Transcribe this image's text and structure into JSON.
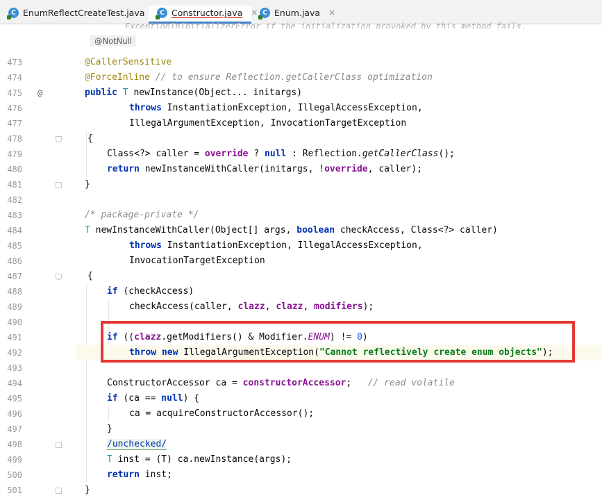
{
  "tabs": [
    {
      "label": "EnumReflectCreateTest.java",
      "icon": "java-class-icon",
      "close": "×",
      "active": false
    },
    {
      "label": "Constructor.java",
      "icon": "java-class-icon",
      "close": "×",
      "active": true
    },
    {
      "label": "Enum.java",
      "icon": "java-class-icon",
      "close": "×",
      "active": false
    }
  ],
  "colors": {
    "highlight_box": "#e53935",
    "keyword": "#0033b3",
    "annotation": "#9e880d",
    "string": "#067d17",
    "field": "#871094",
    "comment": "#8c8c8c"
  },
  "editor": {
    "top_faded_text": "ExceptionInInitializerError if the initialization provoked by this method fails.",
    "notnull_hint": "@NotNull",
    "gutter_marker_475": "@",
    "lines": [
      {
        "n": "473"
      },
      {
        "n": "474"
      },
      {
        "n": "475"
      },
      {
        "n": "476"
      },
      {
        "n": "477"
      },
      {
        "n": "478"
      },
      {
        "n": "479"
      },
      {
        "n": "480"
      },
      {
        "n": "481"
      },
      {
        "n": "482"
      },
      {
        "n": "483"
      },
      {
        "n": "484"
      },
      {
        "n": "485"
      },
      {
        "n": "486"
      },
      {
        "n": "487"
      },
      {
        "n": "488"
      },
      {
        "n": "489"
      },
      {
        "n": "490"
      },
      {
        "n": "491"
      },
      {
        "n": "492"
      },
      {
        "n": "493"
      },
      {
        "n": "494"
      },
      {
        "n": "495"
      },
      {
        "n": "496"
      },
      {
        "n": "497"
      },
      {
        "n": "498"
      },
      {
        "n": "499"
      },
      {
        "n": "500"
      },
      {
        "n": "501"
      }
    ],
    "code": {
      "l473": {
        "ann": "@CallerSensitive"
      },
      "l474": {
        "ann": "@ForceInline",
        "comment": "// to ensure Reflection.getCallerClass optimization"
      },
      "l475": {
        "kw": "public",
        "tp": "T",
        "rest": "newInstance(Object... initargs)"
      },
      "l476": {
        "kw": "throws",
        "rest": "InstantiationException, IllegalAccessException,"
      },
      "l477": {
        "rest": "IllegalArgumentException, InvocationTargetException"
      },
      "l478": {
        "rest": "{"
      },
      "l479": {
        "a": "Class<?> caller = ",
        "f": "override",
        "b": " ? ",
        "kw": "null",
        "c": " : Reflection.",
        "m": "getCallerClass",
        "d": "();"
      },
      "l480": {
        "kw": "return",
        "a": "newInstanceWithCaller(initargs, !",
        "f": "override",
        "b": ", caller);"
      },
      "l481": {
        "rest": "}"
      },
      "l483": {
        "comment": "/* package-private */"
      },
      "l484": {
        "tp": "T",
        "a": "newInstanceWithCaller(Object[] args, ",
        "kw": "boolean",
        "b": "checkAccess, Class<?> caller)"
      },
      "l485": {
        "kw": "throws",
        "rest": "InstantiationException, IllegalAccessException,"
      },
      "l486": {
        "rest": "InvocationTargetException"
      },
      "l487": {
        "rest": "{"
      },
      "l488": {
        "kw": "if",
        "rest": "(checkAccess)"
      },
      "l489": {
        "a": "checkAccess(caller, ",
        "f1": "clazz",
        "b": ", ",
        "f2": "clazz",
        "c": ", ",
        "f3": "modifiers",
        "d": ");"
      },
      "l491": {
        "kw": "if",
        "a": "((",
        "f": "clazz",
        "b": ".getModifiers() & Modifier.",
        "e": "ENUM",
        "c": ") != ",
        "num": "0",
        "d": ")"
      },
      "l492": {
        "kw1": "throw",
        "kw2": "new",
        "a": "IllegalArgumentException(",
        "str": "\"Cannot reflectively create enum objects\"",
        "b": ");"
      },
      "l494": {
        "a": "ConstructorAccessor ca = ",
        "f": "constructorAccessor",
        "b": ";",
        "comment": "// read volatile"
      },
      "l495": {
        "kw": "if",
        "a": "(ca == ",
        "kw2": "null",
        "b": ") {"
      },
      "l496": {
        "rest": "ca = acquireConstructorAccessor();"
      },
      "l497": {
        "rest": "}"
      },
      "l498": {
        "ann": "/unchecked/"
      },
      "l499": {
        "tp": "T",
        "rest": "inst = (T) ca.newInstance(args);"
      },
      "l500": {
        "kw": "return",
        "rest": "inst;"
      },
      "l501": {
        "rest": "}"
      }
    }
  }
}
